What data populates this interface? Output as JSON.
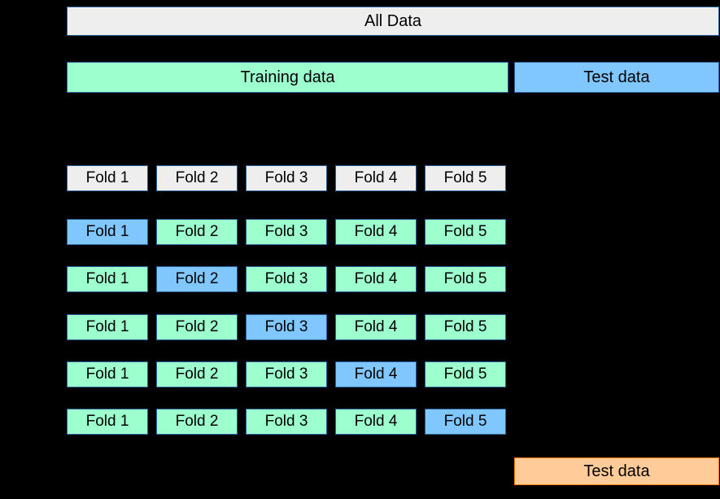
{
  "allData": "All Data",
  "training": "Training data",
  "testTop": "Test data",
  "testBottom": "Test data",
  "folds": {
    "f1": "Fold 1",
    "f2": "Fold 2",
    "f3": "Fold 3",
    "f4": "Fold 4",
    "f5": "Fold 5"
  },
  "rows": [
    {
      "highlight": null,
      "style": "grey"
    },
    {
      "highlight": 1,
      "style": "blue"
    },
    {
      "highlight": 2,
      "style": "blue"
    },
    {
      "highlight": 3,
      "style": "blue"
    },
    {
      "highlight": 4,
      "style": "blue"
    },
    {
      "highlight": 5,
      "style": "blue"
    }
  ]
}
